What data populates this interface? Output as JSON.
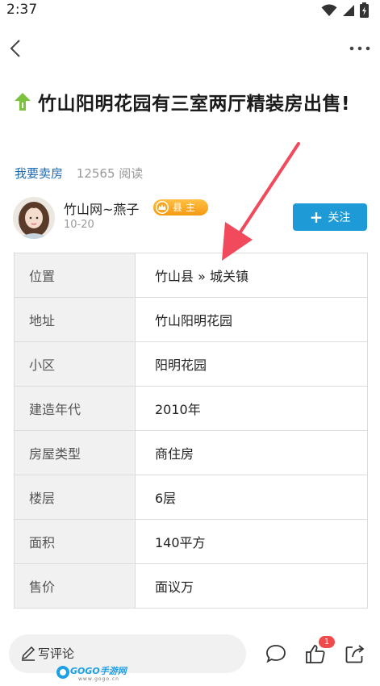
{
  "status_bar": {
    "time": "2:37"
  },
  "post": {
    "title": "竹山阳明花园有三室两厅精装房出售!",
    "category": "我要卖房",
    "read_count": "12565 阅读"
  },
  "author": {
    "name": "竹山网~燕子",
    "badge": "县主",
    "date": "10-20",
    "follow_label": "关注"
  },
  "property_info": [
    {
      "label": "位置",
      "value": "竹山县 » 城关镇"
    },
    {
      "label": "地址",
      "value": "竹山阳明花园"
    },
    {
      "label": "小区",
      "value": "阳明花园"
    },
    {
      "label": "建造年代",
      "value": "2010年"
    },
    {
      "label": "房屋类型",
      "value": "商住房"
    },
    {
      "label": "楼层",
      "value": "6层"
    },
    {
      "label": "面积",
      "value": "140平方"
    },
    {
      "label": "售价",
      "value": "面议万"
    }
  ],
  "bottom_bar": {
    "comment_placeholder": "写评论",
    "like_count": "1"
  },
  "watermark": {
    "brand": "GOGO手游网",
    "url": "www.gogo.cn"
  },
  "colors": {
    "accent": "#1e9ad6",
    "link": "#1e6bb0",
    "badge": "#f5a623",
    "arrow": "#f04a5c"
  }
}
